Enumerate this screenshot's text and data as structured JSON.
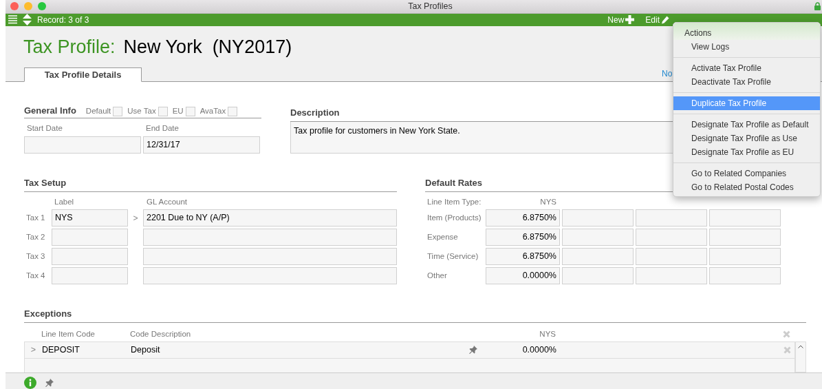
{
  "window": {
    "title": "Tax Profiles"
  },
  "toolbar": {
    "record": "Record: 3 of 3",
    "buttons": [
      {
        "kind": "new",
        "label": "New"
      },
      {
        "kind": "edit",
        "label": "Edit"
      }
    ]
  },
  "header": {
    "prefix": "Tax Profile:",
    "name": "New York  (NY2017)"
  },
  "tabs": [
    {
      "label": "Tax Profile Details",
      "selected": true
    }
  ],
  "side_link": "No",
  "general_info": {
    "title": "General Info",
    "flags": [
      {
        "label": "Default",
        "checked": false
      },
      {
        "label": "Use Tax",
        "checked": false
      },
      {
        "label": "EU",
        "checked": false
      },
      {
        "label": "AvaTax",
        "checked": false
      }
    ],
    "fields": [
      {
        "label": "Start Date"
      },
      {
        "label": "End Date",
        "value": "12/31/17"
      }
    ]
  },
  "description": {
    "title": "Description",
    "text": "Tax profile for customers in New York State."
  },
  "tax_setup": {
    "title": "Tax Setup",
    "label_heading": "Label",
    "account_heading": "GL Account",
    "rows": [
      {
        "label": "Tax 1",
        "code": "NYS",
        "arrow": ">",
        "account": "2201 Due to NY (A/P)"
      },
      {
        "label": "Tax 2"
      },
      {
        "label": "Tax 3"
      },
      {
        "label": "Tax 4"
      }
    ]
  },
  "default_rates": {
    "title": "Default Rates",
    "type_heading": "Line Item Type:",
    "column_heading": "NYS",
    "rows": [
      {
        "label": "Item (Products)",
        "value": "6.8750%"
      },
      {
        "label": "Expense",
        "value": "6.8750%"
      },
      {
        "label": "Time (Service)",
        "value": "6.8750%"
      },
      {
        "label": "Other",
        "value": "0.0000%"
      }
    ]
  },
  "exceptions": {
    "title": "Exceptions",
    "columns": [
      "Line Item Code",
      "Code Description",
      "NYS"
    ],
    "rows": [
      {
        "arrow": ">",
        "code": "DEPOSIT",
        "description": "Deposit",
        "value": "0.0000%"
      }
    ]
  },
  "menu": {
    "title": "Actions",
    "groups": [
      [
        {
          "label": "View Logs",
          "selected": false
        }
      ],
      [
        {
          "label": "Activate Tax Profile",
          "selected": false
        },
        {
          "label": "Deactivate Tax Profile",
          "selected": false
        }
      ],
      [
        {
          "label": "Duplicate Tax Profile",
          "selected": true
        }
      ],
      [
        {
          "label": "Designate Tax Profile as Default",
          "selected": false
        },
        {
          "label": "Designate Tax Profile as Use",
          "selected": false
        },
        {
          "label": "Designate Tax Profile as EU",
          "selected": false
        }
      ],
      [
        {
          "label": "Go to Related Companies",
          "selected": false
        },
        {
          "label": "Go to Related Postal Codes",
          "selected": false
        }
      ]
    ]
  }
}
